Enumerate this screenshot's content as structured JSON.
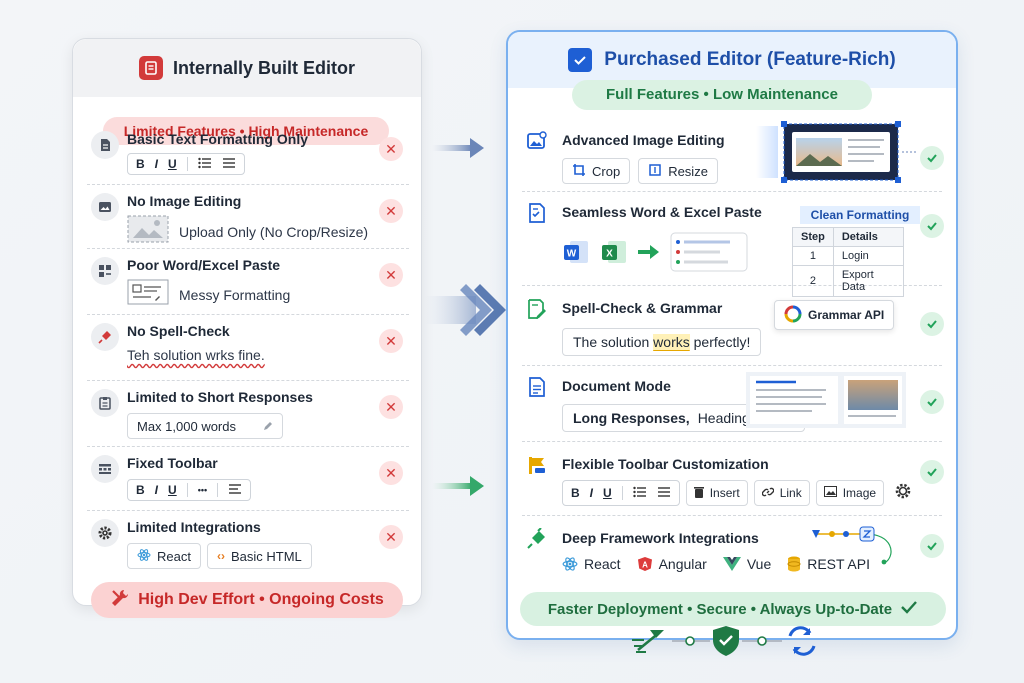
{
  "left": {
    "title": "Internally Built Editor",
    "subtitle": "Limited Features • High Maintenance",
    "rows": [
      {
        "title": "Basic Text Formatting Only"
      },
      {
        "title": "No Image Editing",
        "text": "Upload Only (No Crop/Resize)"
      },
      {
        "title": "Poor Word/Excel Paste",
        "text": "Messy Formatting"
      },
      {
        "title": "No Spell-Check",
        "text": "Teh solution wrks fine."
      },
      {
        "title": "Limited to Short Responses",
        "text": "Max 1,000 words"
      },
      {
        "title": "Fixed Toolbar"
      },
      {
        "title": "Limited Integrations",
        "chips": [
          "React",
          "Basic HTML"
        ]
      }
    ],
    "footer": "High Dev Effort • Ongoing Costs",
    "x_mark": "✕"
  },
  "right": {
    "title": "Purchased Editor (Feature-Rich)",
    "subtitle": "Full Features • Low Maintenance",
    "rows": [
      {
        "title": "Advanced Image Editing",
        "chips": [
          "Crop",
          "Resize"
        ]
      },
      {
        "title": "Seamless Word & Excel Paste",
        "table_caption": "Clean Formatting",
        "table_head": [
          "Step",
          "Details"
        ],
        "table_rows": [
          [
            "1",
            "Login"
          ],
          [
            "2",
            "Export Data"
          ]
        ]
      },
      {
        "title": "Spell-Check & Grammar",
        "text_before": "The solution ",
        "text_mark": "works",
        "text_after": " perfectly!",
        "api": "Grammar API"
      },
      {
        "title": "Document Mode",
        "text_bold": "Long Responses,",
        "text": "Headings, TOC"
      },
      {
        "title": "Flexible Toolbar Customization",
        "chips": [
          "Insert",
          "Link",
          "Image"
        ]
      },
      {
        "title": "Deep Framework Integrations",
        "frameworks": [
          "React",
          "Angular",
          "Vue",
          "REST API"
        ]
      }
    ],
    "footer": "Faster Deployment • Secure • Always Up-to-Date"
  },
  "toolbar": {
    "b": "B",
    "i": "I",
    "u": "U",
    "dots": "•••"
  },
  "colors": {
    "red": "#d23a3a",
    "green": "#22a35a",
    "blue": "#1e5fd4"
  }
}
